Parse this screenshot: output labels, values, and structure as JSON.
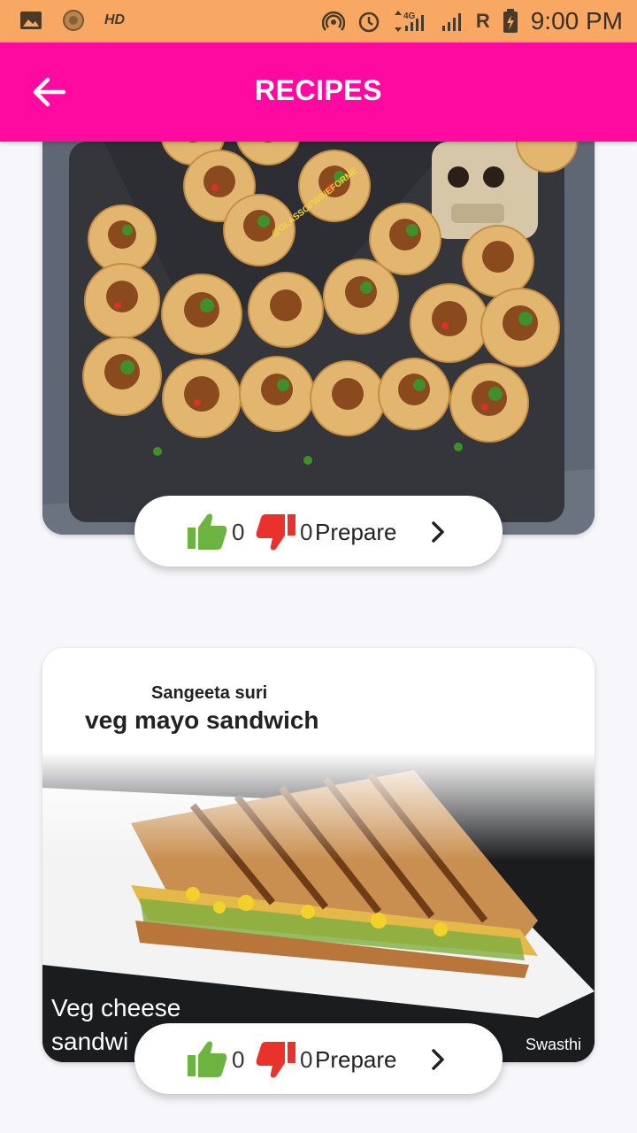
{
  "status_bar": {
    "hd": "HD",
    "network": "4G",
    "roaming": "R",
    "time": "9:00 PM"
  },
  "app_bar": {
    "title": "RECIPES",
    "back_icon": "arrow-left-icon"
  },
  "colors": {
    "status_bar": "#f8a862",
    "app_bar": "#ff0aa0",
    "like": "#6db33f",
    "dislike": "#e8322b"
  },
  "recipes": [
    {
      "photo_watermark": "@GLASSOFWINEFORME",
      "likes": "0",
      "dislikes": "0",
      "prepare_label": "Prepare"
    },
    {
      "author": "Sangeeta suri",
      "title": "veg mayo sandwich",
      "photo_caption_line1": "Veg cheese",
      "photo_caption_line2": "sandwi",
      "photo_credit": "Swasthi",
      "likes": "0",
      "dislikes": "0",
      "prepare_label": "Prepare"
    }
  ]
}
